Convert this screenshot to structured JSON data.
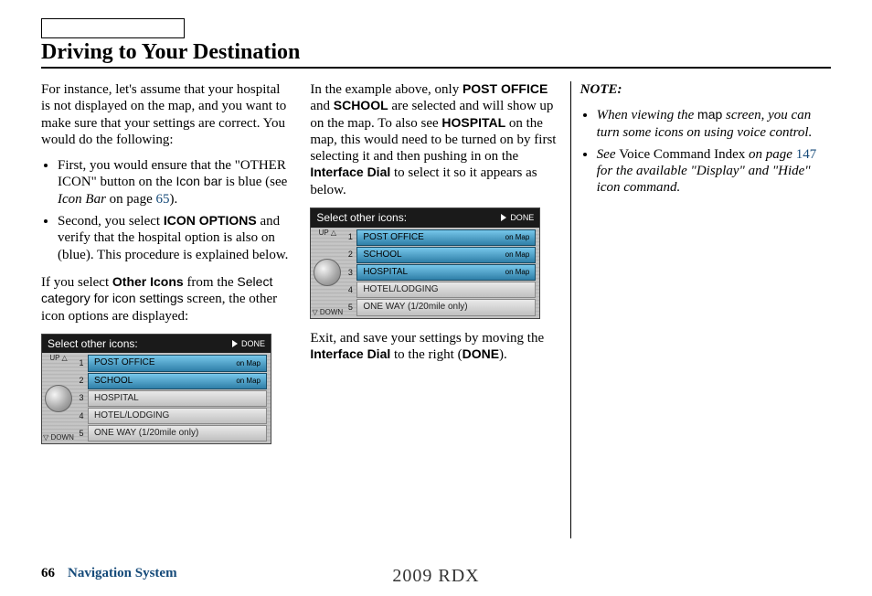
{
  "header": {
    "title": "Driving to Your Destination"
  },
  "col1": {
    "intro": "For instance, let's assume that your hospital is not displayed on the map, and you want to make sure that your settings are correct. You would do the following:",
    "bullet1_a": "First, you would ensure that the \"OTHER ICON\" button on the ",
    "bullet1_iconbar": "Icon bar",
    "bullet1_b": " is blue (see ",
    "bullet1_ital": "Icon Bar",
    "bullet1_c": " on page ",
    "bullet1_link": "65",
    "bullet1_d": ").",
    "bullet2_a": "Second, you select ",
    "bullet2_bold": "ICON OPTIONS",
    "bullet2_b": " and verify that the hospital option is also on (blue). This procedure is explained below.",
    "para2_a": "If you select ",
    "para2_bold": "Other Icons",
    "para2_b": " from the ",
    "para2_sans": "Select category for icon settings",
    "para2_c": " screen, the other icon options are displayed:"
  },
  "screen1": {
    "title": "Select other icons:",
    "done": "DONE",
    "up": "UP\n△",
    "down": "▽\nDOWN",
    "nums": [
      "1",
      "2",
      "3",
      "4",
      "5"
    ],
    "rows": [
      {
        "label": "POST OFFICE",
        "tag": "on Map",
        "sel": true
      },
      {
        "label": "SCHOOL",
        "tag": "on Map",
        "sel": true
      },
      {
        "label": "HOSPITAL",
        "tag": "",
        "sel": false
      },
      {
        "label": "HOTEL/LODGING",
        "tag": "",
        "sel": false
      },
      {
        "label": "ONE WAY (1/20mile only)",
        "tag": "",
        "sel": false
      }
    ]
  },
  "col2": {
    "para1_a": "In the example above, only ",
    "para1_b1": "POST OFFICE",
    "para1_b": " and ",
    "para1_b2": "SCHOOL",
    "para1_c": " are selected and will show up on the map. To also see ",
    "para1_b3": "HOSPITAL",
    "para1_d": " on the map, this would need to be turned on by first selecting it and then pushing in on the ",
    "para1_b4": "Interface Dial",
    "para1_e": " to select it so it appears as below.",
    "para2_a": "Exit, and save your settings by moving the ",
    "para2_b1": "Interface Dial",
    "para2_b": " to the right (",
    "para2_b2": "DONE",
    "para2_c": ")."
  },
  "screen2": {
    "title": "Select other icons:",
    "done": "DONE",
    "up": "UP\n△",
    "down": "▽\nDOWN",
    "nums": [
      "1",
      "2",
      "3",
      "4",
      "5"
    ],
    "rows": [
      {
        "label": "POST OFFICE",
        "tag": "on Map",
        "sel": true
      },
      {
        "label": "SCHOOL",
        "tag": "on Map",
        "sel": true
      },
      {
        "label": "HOSPITAL",
        "tag": "on Map",
        "sel": true
      },
      {
        "label": "HOTEL/LODGING",
        "tag": "",
        "sel": false
      },
      {
        "label": "ONE WAY (1/20mile only)",
        "tag": "",
        "sel": false
      }
    ]
  },
  "col3": {
    "note": "NOTE:",
    "bullet1_a": "When viewing the ",
    "bullet1_sans": "map",
    "bullet1_b": " screen, you can turn some icons on using voice control.",
    "bullet2_a": "See ",
    "bullet2_roman": "Voice Command Index",
    "bullet2_b": " on page ",
    "bullet2_link": "147",
    "bullet2_c": " for the available \"Display\" and \"Hide\" icon command."
  },
  "footer": {
    "page": "66",
    "label": "Navigation System",
    "model": "2009 RDX"
  }
}
